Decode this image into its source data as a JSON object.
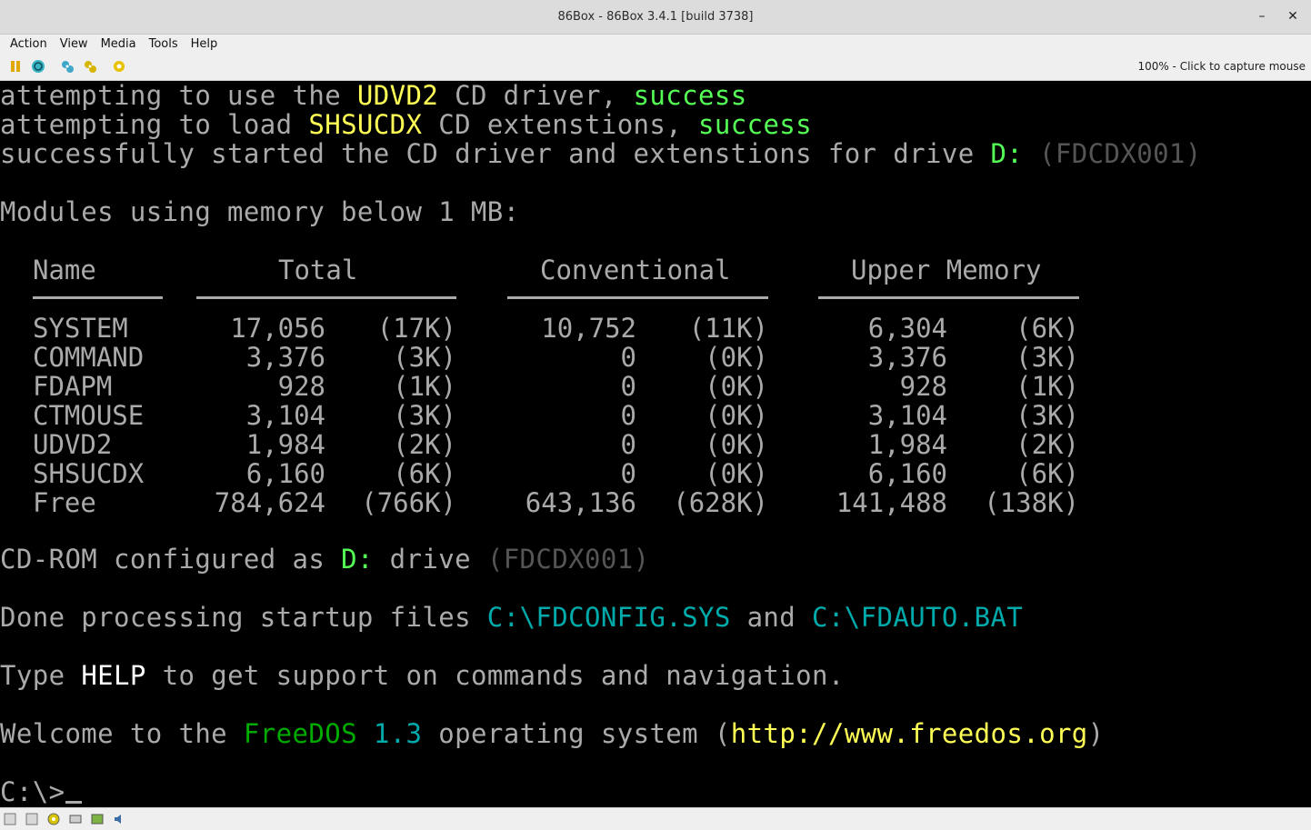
{
  "window": {
    "title": "86Box - 86Box 3.4.1 [build 3738]",
    "minimize_glyph": "–",
    "close_glyph": "✕"
  },
  "menu": [
    "Action",
    "View",
    "Media",
    "Tools",
    "Help"
  ],
  "toolbar": {
    "icons": [
      "pause-icon",
      "reset-icon",
      "ctrl-alt-del-icon",
      "ctrl-alt-esc-icon",
      "settings-icon"
    ],
    "status": "100% - Click to capture mouse"
  },
  "terminal": {
    "line1": {
      "a": "attempting to use the ",
      "b": "UDVD2",
      "c": " CD driver, ",
      "d": "success"
    },
    "line2": {
      "a": "attempting to load ",
      "b": "SHSUCDX",
      "c": " CD extenstions, ",
      "d": "success"
    },
    "line3": {
      "a": "successfully started the CD driver and extenstions for drive ",
      "b": "D:",
      "c": " ",
      "d": "(FDCDX001)"
    },
    "modules_heading": "Modules using memory below 1 MB:",
    "headers": {
      "name": "Name",
      "total": "Total",
      "conventional": "Conventional",
      "upper": "Upper Memory"
    },
    "rows": [
      {
        "name": "SYSTEM",
        "total": "17,056",
        "total_k": "(17K)",
        "conv": "10,752",
        "conv_k": "(11K)",
        "upper": "6,304",
        "upper_k": "(6K)"
      },
      {
        "name": "COMMAND",
        "total": "3,376",
        "total_k": "(3K)",
        "conv": "0",
        "conv_k": "(0K)",
        "upper": "3,376",
        "upper_k": "(3K)"
      },
      {
        "name": "FDAPM",
        "total": "928",
        "total_k": "(1K)",
        "conv": "0",
        "conv_k": "(0K)",
        "upper": "928",
        "upper_k": "(1K)"
      },
      {
        "name": "CTMOUSE",
        "total": "3,104",
        "total_k": "(3K)",
        "conv": "0",
        "conv_k": "(0K)",
        "upper": "3,104",
        "upper_k": "(3K)"
      },
      {
        "name": "UDVD2",
        "total": "1,984",
        "total_k": "(2K)",
        "conv": "0",
        "conv_k": "(0K)",
        "upper": "1,984",
        "upper_k": "(2K)"
      },
      {
        "name": "SHSUCDX",
        "total": "6,160",
        "total_k": "(6K)",
        "conv": "0",
        "conv_k": "(0K)",
        "upper": "6,160",
        "upper_k": "(6K)"
      },
      {
        "name": "Free",
        "total": "784,624",
        "total_k": "(766K)",
        "conv": "643,136",
        "conv_k": "(628K)",
        "upper": "141,488",
        "upper_k": "(138K)"
      }
    ],
    "cdrom": {
      "a": "CD-ROM configured as ",
      "b": "D:",
      "c": " drive ",
      "d": "(FDCDX001)"
    },
    "done": {
      "a": "Done processing startup files ",
      "b": "C:\\FDCONFIG.SYS",
      "c": " and ",
      "d": "C:\\FDAUTO.BAT"
    },
    "help": {
      "a": "Type ",
      "b": "HELP",
      "c": " to get support on commands and navigation."
    },
    "welcome": {
      "a": "Welcome to the ",
      "b": "FreeDOS",
      "c": " ",
      "d": "1.3",
      "e": " operating system (",
      "f": "http://www.freedos.org",
      "g": ")"
    },
    "prompt": "C:\\>"
  },
  "statusbar": {
    "icons": [
      "floppy-a-icon",
      "floppy-b-icon",
      "cdrom-icon",
      "network-icon",
      "hard-disk-icon",
      "sound-icon"
    ]
  },
  "colors": {
    "yellow": "#ffff55",
    "bright_green": "#55ff55",
    "green": "#00aa00",
    "cyan": "#00aaaa",
    "gray": "#aaaaaa",
    "dark_gray": "#555555",
    "white": "#ffffff"
  }
}
